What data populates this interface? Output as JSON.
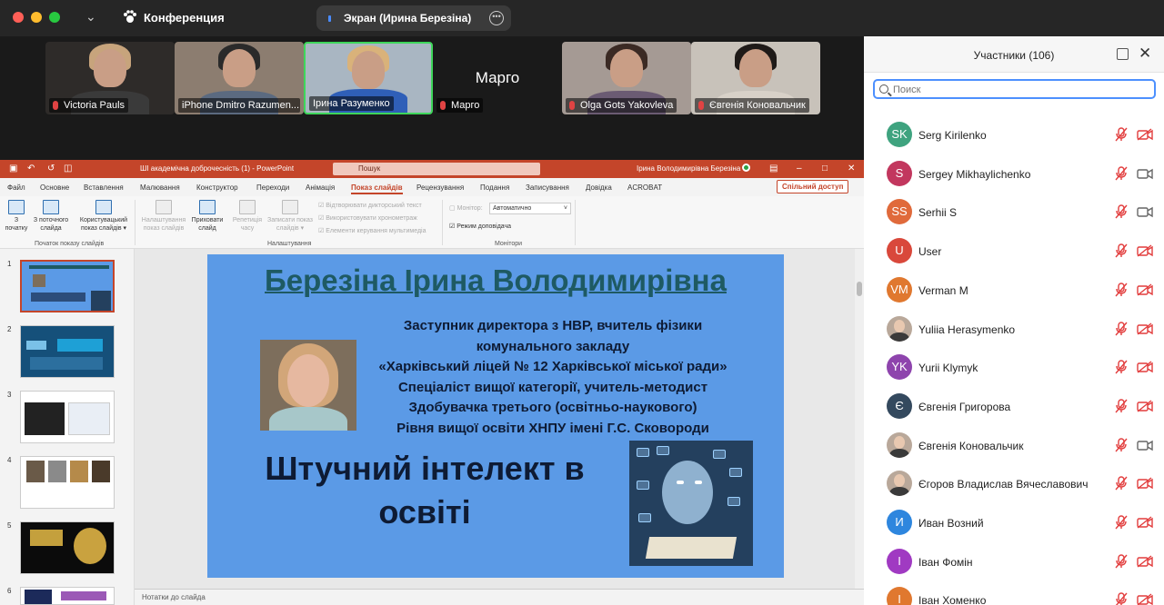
{
  "titlebar": {
    "app_title": "Конференция",
    "screen_share_label": "Экран (Ирина Березіна)",
    "traffic_colors": [
      "#ff5f57",
      "#febc2e",
      "#28c840"
    ]
  },
  "video_tiles": [
    {
      "name": "Victoria Pauls",
      "hair": "#c7a47c",
      "body": "#3a3a3a",
      "bg": "#2e2b29"
    },
    {
      "name": "iPhone Dmitro Razumen...",
      "hair": "#2a2a2a",
      "body": "#5b6a80",
      "bg": "#8c7d70"
    },
    {
      "name": "Ірина Разуменко",
      "hair": "#d9b27a",
      "body": "#2f5fb8",
      "bg": "#a9b6c2"
    },
    {
      "name": "Марго",
      "nocam_title": "Марго"
    },
    {
      "name": "Olga Gots Yakovleva",
      "hair": "#3b2a24",
      "body": "#6b5b73",
      "bg": "#a59a94"
    },
    {
      "name": "Євгенія Коновальчик",
      "hair": "#1f1a18",
      "body": "#d8d1c8",
      "bg": "#c8c2ba"
    }
  ],
  "ppt": {
    "doc_title": "ШІ академічна доброчесність (1) - PowerPoint",
    "search_placeholder": "Пошук",
    "user_name": "Ірина Володимирівна Березіна",
    "tabs": [
      "Файл",
      "Основне",
      "Вставлення",
      "Малювання",
      "Конструктор",
      "Переходи",
      "Анімація",
      "Показ слайдів",
      "Рецензування",
      "Подання",
      "Записування",
      "Довідка",
      "ACROBAT"
    ],
    "active_tab": "Показ слайдів",
    "share_label": "Спільний доступ",
    "ribbon": {
      "from_start": "З\nпочатку",
      "from_current": "З поточного\nслайда",
      "custom_show": "Користувацький\nпоказ слайдів ▾",
      "setup_show": "Налаштування\nпоказ слайдів",
      "hide_slide": "Приховати\nслайд",
      "rehearse": "Репетиція\nчасу",
      "record": "Записати показ\nслайдів ▾",
      "chk_narration": "Відтворювати дикторський текст",
      "chk_timings": "Використовувати хронометраж",
      "chk_media": "Елементи керування мультимедіа",
      "monitor_label": "Монітор:",
      "monitor_value": "Автоматично",
      "presenter_view": "Режим доповідача",
      "group_start": "Початок показу слайдів",
      "group_setup": "Налаштування",
      "group_monitors": "Монітори"
    },
    "slide_numbers": [
      "1",
      "2",
      "3",
      "4",
      "5",
      "6"
    ],
    "notes_label": "Нотатки до слайда",
    "slide": {
      "title": "Березіна Ірина Володимирівна",
      "lines": [
        "Заступник директора з НВР, вчитель фізики",
        "комунального закладу",
        "«Харківський ліцей № 12 Харківської міської ради»",
        "Спеціаліст вищої категорії, учитель-методист",
        "Здобувачка третього (освітньо-наукового)",
        "Рівня вищої освіти ХНПУ імені Г.С. Сковороди"
      ],
      "big_line1": "Штучний інтелект в",
      "big_line2": "освіті"
    }
  },
  "participants_panel": {
    "title": "Участники (106)",
    "search_placeholder": "Поиск",
    "participants": [
      {
        "initials": "SK",
        "name": "Serg Kirilenko",
        "color": "#3fa37f",
        "cam": "off"
      },
      {
        "initials": "S",
        "name": "Sergey Mikhaylichenko",
        "color": "#c2375e",
        "cam": "on"
      },
      {
        "initials": "SS",
        "name": "Serhii S",
        "color": "#e06a3b",
        "cam": "on"
      },
      {
        "initials": "U",
        "name": "User",
        "color": "#d9483b",
        "cam": "off"
      },
      {
        "initials": "VM",
        "name": "Verman M",
        "color": "#e0782f",
        "cam": "off"
      },
      {
        "initials": "",
        "name": "Yuliia Herasymenko",
        "color": "photo",
        "cam": "off"
      },
      {
        "initials": "YK",
        "name": "Yurii Klymyk",
        "color": "#8e44ad",
        "cam": "off"
      },
      {
        "initials": "Є",
        "name": "Євгенія Григорова",
        "color": "#34495e",
        "cam": "off"
      },
      {
        "initials": "",
        "name": "Євгенія Коновальчик",
        "color": "photo",
        "cam": "on"
      },
      {
        "initials": "",
        "name": "Єгоров Владислав Вячеславович",
        "color": "photo",
        "cam": "off"
      },
      {
        "initials": "И",
        "name": "Иван Возний",
        "color": "#2e86de",
        "cam": "off"
      },
      {
        "initials": "І",
        "name": "Іван Фомін",
        "color": "#a03ac2",
        "cam": "off"
      },
      {
        "initials": "І",
        "name": "Іван Хоменко",
        "color": "#e0782f",
        "cam": "off"
      }
    ]
  }
}
